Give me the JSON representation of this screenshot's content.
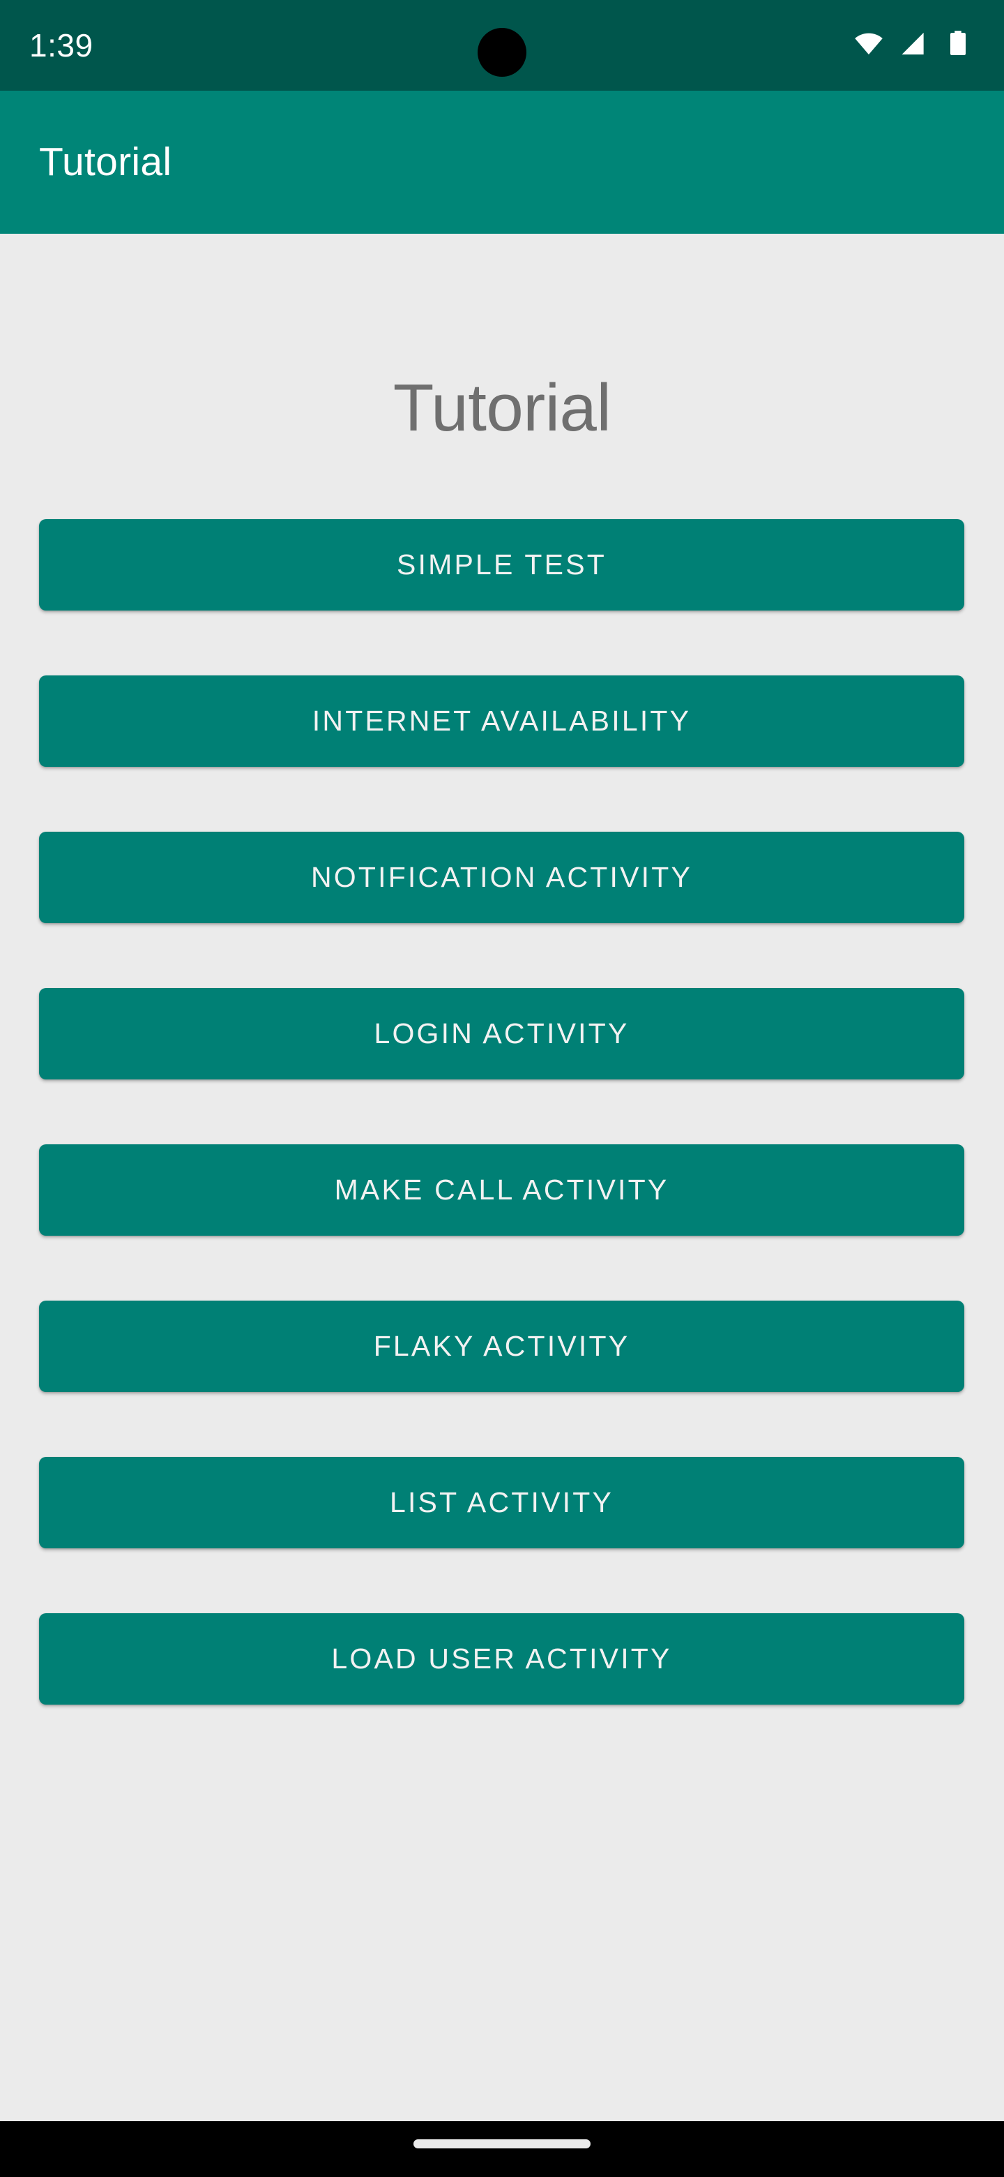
{
  "status_bar": {
    "time": "1:39",
    "background_color": "#00564C",
    "text_color": "#FFFFFF",
    "icons": [
      {
        "name": "wifi-icon",
        "label": "wifi"
      },
      {
        "name": "cellular-signal-icon",
        "label": "signal"
      },
      {
        "name": "battery-icon",
        "label": "battery"
      }
    ],
    "camera_cutout": "camera-punch-hole"
  },
  "app_bar": {
    "title": "Tutorial",
    "background_color": "#008577",
    "title_color": "#FFFFFF"
  },
  "content": {
    "background_color": "#EBEBEB",
    "heading": "Tutorial",
    "heading_color": "#6F6F6F",
    "buttons": [
      {
        "label": "SIMPLE TEST",
        "name": "simple-test-button"
      },
      {
        "label": "INTERNET AVAILABILITY",
        "name": "internet-availability-button"
      },
      {
        "label": "NOTIFICATION ACTIVITY",
        "name": "notification-activity-button"
      },
      {
        "label": "LOGIN ACTIVITY",
        "name": "login-activity-button"
      },
      {
        "label": "MAKE CALL ACTIVITY",
        "name": "make-call-activity-button"
      },
      {
        "label": "FLAKY ACTIVITY",
        "name": "flaky-activity-button"
      },
      {
        "label": "LIST ACTIVITY",
        "name": "list-activity-button"
      },
      {
        "label": "LOAD USER ACTIVITY",
        "name": "load-user-activity-button"
      }
    ],
    "button_color": "#008075",
    "button_text_color": "#F2F2F2"
  },
  "nav_bar": {
    "background_color": "#000000",
    "gesture_pill_color": "#EBEBEB"
  }
}
